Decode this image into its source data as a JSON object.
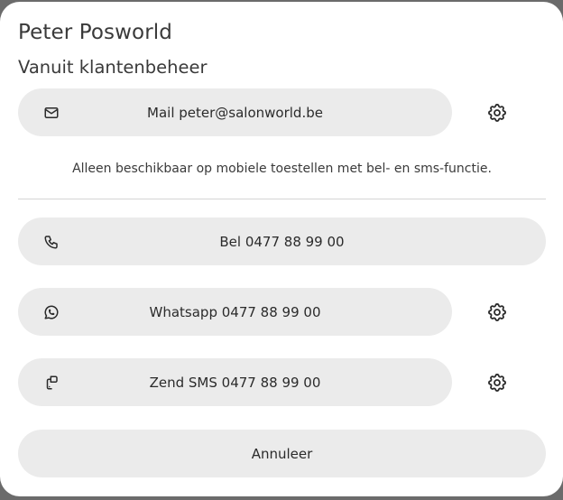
{
  "dialog": {
    "title": "Peter Posworld",
    "subtitle": "Vanuit klantenbeheer",
    "mail": {
      "label": "Mail peter@salonworld.be",
      "icon": "mail-icon"
    },
    "note": "Alleen beschikbaar op mobiele toestellen met bel- en sms-functie.",
    "call": {
      "label": "Bel 0477 88 99 00",
      "icon": "phone-icon"
    },
    "whatsapp": {
      "label": "Whatsapp 0477 88 99 00",
      "icon": "whatsapp-icon"
    },
    "sms": {
      "label": "Zend SMS 0477 88 99 00",
      "icon": "sms-icon"
    },
    "cancel": {
      "label": "Annuleer"
    }
  },
  "colors": {
    "button_bg": "#ebebeb",
    "text": "#2b2b2b",
    "overlay": "#6b6b6b"
  }
}
